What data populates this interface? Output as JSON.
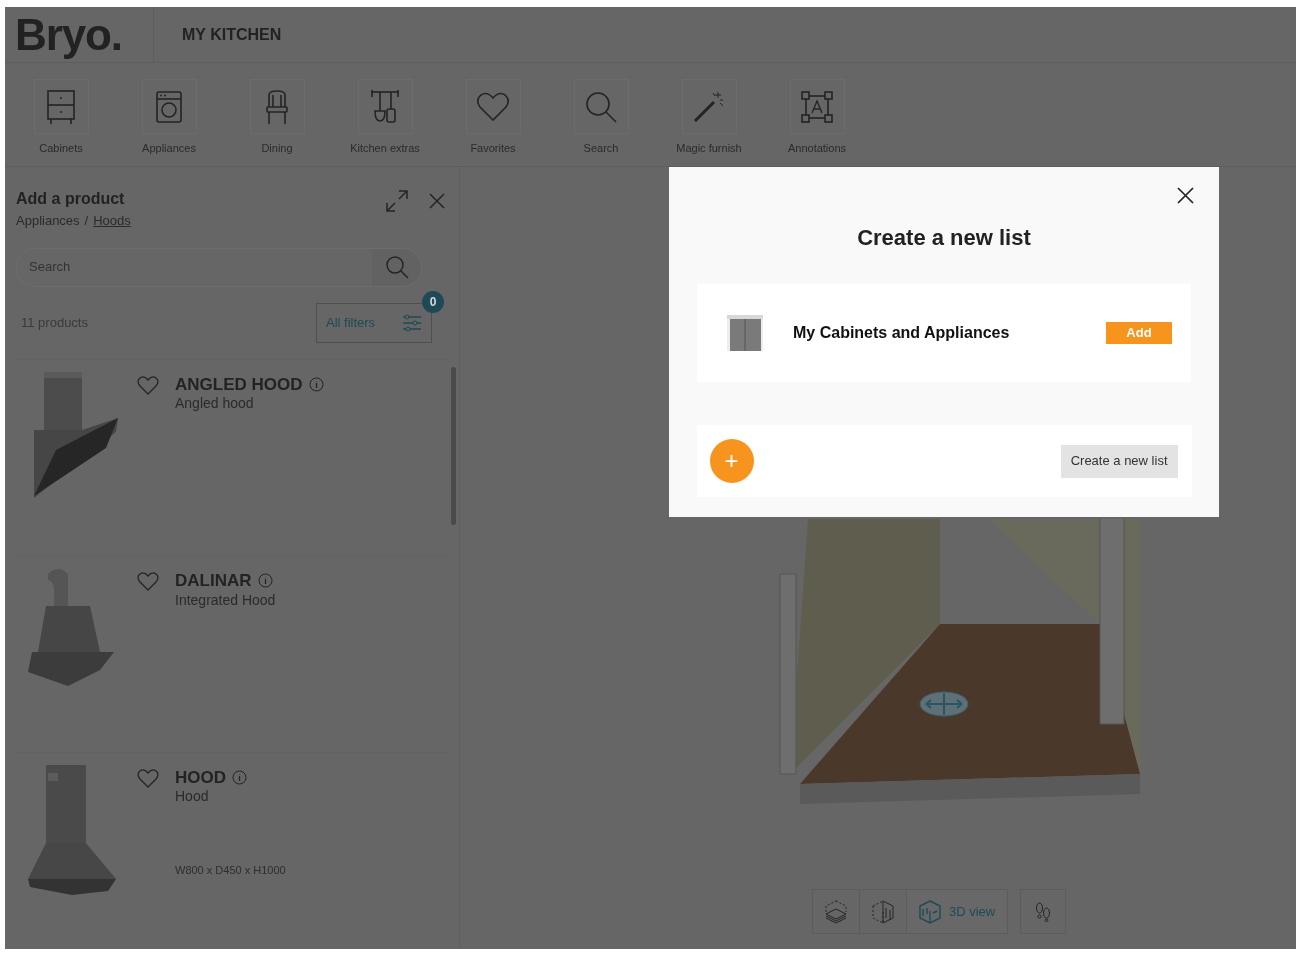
{
  "header": {
    "logo": "Bryo.",
    "project_title": "MY KITCHEN"
  },
  "toolbar": [
    {
      "kind": "cabinet",
      "label": "Cabinets"
    },
    {
      "kind": "appliance",
      "label": "Appliances"
    },
    {
      "kind": "chair",
      "label": "Dining"
    },
    {
      "kind": "utensils",
      "label": "Kitchen extras"
    },
    {
      "kind": "heart",
      "label": "Favorites"
    },
    {
      "kind": "search",
      "label": "Search"
    },
    {
      "kind": "wand",
      "label": "Magic furnish"
    },
    {
      "kind": "annotation",
      "label": "Annotations"
    }
  ],
  "panel": {
    "title": "Add a product",
    "breadcrumb": [
      {
        "label": "Appliances",
        "link": false
      },
      {
        "label": "Hoods",
        "link": true
      }
    ],
    "breadcrumb_separator": "/",
    "search": {
      "placeholder": "Search"
    },
    "count": "11 products",
    "filters": {
      "label": "All filters",
      "badge": "0"
    },
    "products": [
      {
        "kind": "angled",
        "name": "ANGLED HOOD",
        "description": "Angled hood",
        "favorite": false
      },
      {
        "kind": "dalinar",
        "name": "DALINAR",
        "description": "Integrated Hood",
        "favorite": false
      },
      {
        "kind": "chimney",
        "name": "HOOD",
        "description": "Hood",
        "dimensions": "W800 x D450 x H1000",
        "favorite": false
      }
    ]
  },
  "view_controls": [
    {
      "kind": "floor",
      "selected": false
    },
    {
      "kind": "wall",
      "selected": false
    },
    {
      "kind": "room",
      "label": "3D view",
      "selected": true
    }
  ],
  "modal": {
    "title": "Create a new list",
    "lists": [
      {
        "name": "My Cabinets and Appliances",
        "action": "Add"
      }
    ],
    "create_button": "Create a new list",
    "add_symbol": "+"
  }
}
